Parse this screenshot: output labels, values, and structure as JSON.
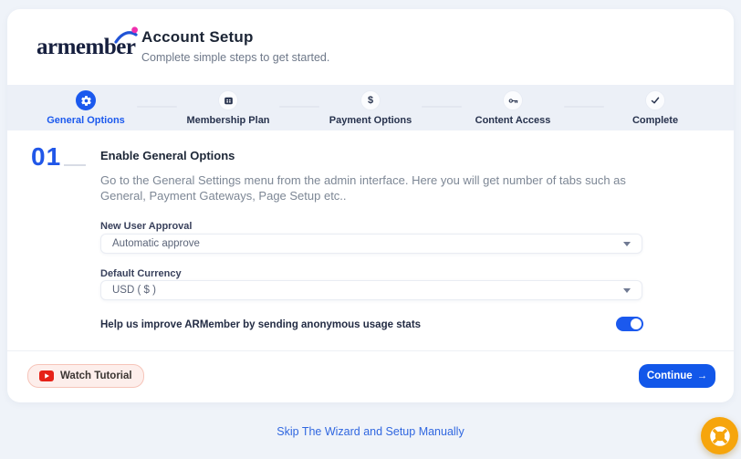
{
  "header": {
    "logo_text": "armember",
    "title": "Account Setup",
    "subtitle": "Complete simple steps to get started."
  },
  "stepper": {
    "dollar_glyph": "$",
    "steps": [
      {
        "label": "General Options",
        "icon": "gear-icon",
        "active": true
      },
      {
        "label": "Membership Plan",
        "icon": "membership-card-icon",
        "active": false
      },
      {
        "label": "Payment Options",
        "icon": "dollar-icon",
        "active": false
      },
      {
        "label": "Content Access",
        "icon": "key-icon",
        "active": false
      },
      {
        "label": "Complete",
        "icon": "check-icon",
        "active": false
      }
    ]
  },
  "content": {
    "step_number": "01",
    "heading": "Enable General Options",
    "description": "Go to the General Settings menu from the admin interface. Here you will get number of tabs such as General, Payment Gateways, Page Setup etc..",
    "fields": [
      {
        "label": "New User Approval",
        "value": "Automatic approve"
      },
      {
        "label": "Default Currency",
        "value": "USD ( $ )"
      }
    ],
    "toggle": {
      "label": "Help us improve ARMember by sending anonymous usage stats",
      "state": "on"
    }
  },
  "footer": {
    "watch_tutorial_label": "Watch Tutorial",
    "continue_label": "Continue",
    "continue_arrow": "→"
  },
  "bottom": {
    "skip_link_label": "Skip The Wizard and Setup Manually"
  },
  "colors": {
    "accent_blue": "#1b59ee",
    "stepper_bg": "#ecf0f7",
    "page_bg": "#eff3f9",
    "orange_fab": "#f6a50c",
    "youtube_red": "#e62117",
    "pink_logo_dot": "#ef2fae"
  }
}
